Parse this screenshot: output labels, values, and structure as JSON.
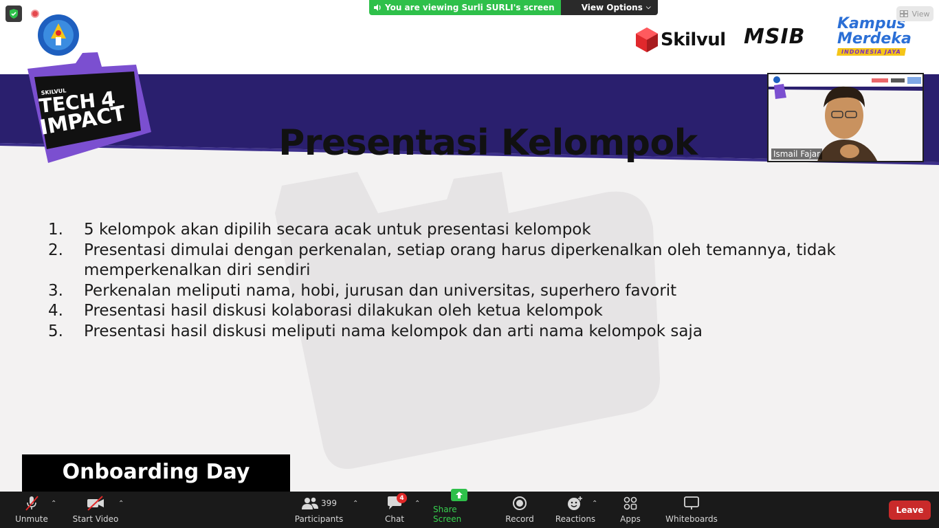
{
  "share_banner": {
    "viewing_text": "You are viewing Surli SURLI's screen",
    "view_options_label": "View Options"
  },
  "view_button_label": "View",
  "slide": {
    "title": "Presentasi Kelompok",
    "items": [
      {
        "num": "1.",
        "text": "5 kelompok akan dipilih secara acak untuk presentasi kelompok"
      },
      {
        "num": "2.",
        "text": "Presentasi dimulai dengan perkenalan, setiap orang harus diperkenalkan oleh temannya, tidak memperkenalkan diri sendiri"
      },
      {
        "num": "3.",
        "text": "Perkenalan meliputi nama, hobi, jurusan dan universitas, superhero favorit"
      },
      {
        "num": "4.",
        "text": "Presentasi hasil diskusi kolaborasi dilakukan oleh ketua kelompok"
      },
      {
        "num": "5.",
        "text": "Presentasi hasil diskusi meliputi nama kelompok dan arti nama kelompok saja"
      }
    ],
    "badge": {
      "small": "SKILVUL",
      "line1": "TECH",
      "digit": "4",
      "line2": "IMPACT"
    },
    "brands": {
      "skilvul": "Skilvul",
      "msib": "MSIB",
      "kampus_line1": "Kampus",
      "kampus_line2": "Merdeka",
      "kampus_tag": "INDONESIA JAYA"
    },
    "footer_banner": "Onboarding Day"
  },
  "video_thumb": {
    "participant_name": "Ismail Fajar"
  },
  "toolbar": {
    "unmute": "Unmute",
    "start_video": "Start Video",
    "participants": "Participants",
    "participants_count": "399",
    "chat": "Chat",
    "chat_badge": "4",
    "share_screen": "Share Screen",
    "record": "Record",
    "reactions": "Reactions",
    "apps": "Apps",
    "whiteboards": "Whiteboards",
    "leave": "Leave"
  },
  "colors": {
    "purple_band": "#2a1f6e",
    "badge_purple": "#7b4fd0",
    "share_green": "#2ec04a",
    "leave_red": "#c92a2a"
  }
}
